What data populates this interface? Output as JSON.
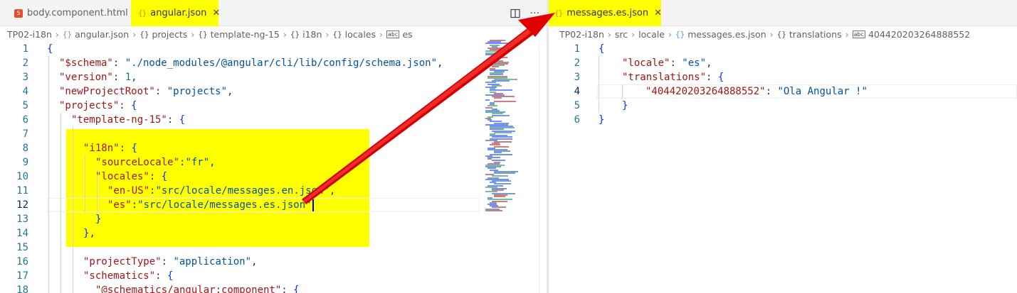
{
  "left": {
    "tabs": [
      {
        "name": "body.component.html",
        "icon": "html5-icon",
        "active": false
      },
      {
        "name": "angular.json",
        "icon": "json-braces-icon",
        "active": true,
        "close": "✕"
      }
    ],
    "actions": {
      "split": "split-editor-icon",
      "more": "···"
    },
    "breadcrumb": [
      {
        "label": "TP02-i18n",
        "icon": ""
      },
      {
        "label": "angular.json",
        "icon": "{}"
      },
      {
        "label": "projects",
        "icon": "{}"
      },
      {
        "label": "template-ng-15",
        "icon": "{}"
      },
      {
        "label": "i18n",
        "icon": "{}"
      },
      {
        "label": "locales",
        "icon": "{}"
      },
      {
        "label": "es",
        "icon": "abc"
      }
    ],
    "lines": [
      {
        "n": "1",
        "indent": 0,
        "tokens": [
          [
            "p",
            "{"
          ]
        ]
      },
      {
        "n": "2",
        "indent": 1,
        "tokens": [
          [
            "k",
            "\"$schema\""
          ],
          [
            "x",
            ": "
          ],
          [
            "s",
            "\"./node_modules/@angular/cli/lib/config/schema.json\""
          ],
          [
            "x",
            ","
          ]
        ]
      },
      {
        "n": "3",
        "indent": 1,
        "tokens": [
          [
            "k",
            "\"version\""
          ],
          [
            "x",
            ": "
          ],
          [
            "n",
            "1"
          ],
          [
            "x",
            ","
          ]
        ]
      },
      {
        "n": "4",
        "indent": 1,
        "tokens": [
          [
            "k",
            "\"newProjectRoot\""
          ],
          [
            "x",
            ": "
          ],
          [
            "s",
            "\"projects\""
          ],
          [
            "x",
            ","
          ]
        ]
      },
      {
        "n": "5",
        "indent": 1,
        "tokens": [
          [
            "k",
            "\"projects\""
          ],
          [
            "x",
            ": "
          ],
          [
            "p",
            "{"
          ]
        ]
      },
      {
        "n": "6",
        "indent": 2,
        "tokens": [
          [
            "k",
            "\"template-ng-15\""
          ],
          [
            "x",
            ": "
          ],
          [
            "p",
            "{"
          ]
        ]
      },
      {
        "n": "7",
        "indent": 0,
        "tokens": []
      },
      {
        "n": "8",
        "indent": 3,
        "tokens": [
          [
            "k",
            "\"i18n\""
          ],
          [
            "x",
            ": "
          ],
          [
            "p",
            "{"
          ]
        ]
      },
      {
        "n": "9",
        "indent": 4,
        "tokens": [
          [
            "k",
            "\"sourceLocale\""
          ],
          [
            "x",
            ":"
          ],
          [
            "s",
            "\"fr\""
          ],
          [
            "x",
            ","
          ]
        ]
      },
      {
        "n": "10",
        "indent": 4,
        "tokens": [
          [
            "k",
            "\"locales\""
          ],
          [
            "x",
            ": "
          ],
          [
            "p",
            "{"
          ]
        ]
      },
      {
        "n": "11",
        "indent": 5,
        "tokens": [
          [
            "k",
            "\"en-US\""
          ],
          [
            "x",
            ":"
          ],
          [
            "s",
            "\"src/locale/messages.en.json\""
          ],
          [
            "x",
            ","
          ]
        ]
      },
      {
        "n": "12",
        "indent": 5,
        "tokens": [
          [
            "k",
            "\"es\""
          ],
          [
            "x",
            ":"
          ],
          [
            "s",
            "\"src/locale/messages.es.json\""
          ]
        ],
        "cursor": true
      },
      {
        "n": "13",
        "indent": 4,
        "tokens": [
          [
            "p",
            "}"
          ]
        ]
      },
      {
        "n": "14",
        "indent": 3,
        "tokens": [
          [
            "p",
            "}"
          ],
          [
            "x",
            ","
          ]
        ]
      },
      {
        "n": "15",
        "indent": 0,
        "tokens": []
      },
      {
        "n": "16",
        "indent": 3,
        "tokens": [
          [
            "k",
            "\"projectType\""
          ],
          [
            "x",
            ": "
          ],
          [
            "s",
            "\"application\""
          ],
          [
            "x",
            ","
          ]
        ]
      },
      {
        "n": "17",
        "indent": 3,
        "tokens": [
          [
            "k",
            "\"schematics\""
          ],
          [
            "x",
            ": "
          ],
          [
            "p",
            "{"
          ]
        ]
      },
      {
        "n": "18",
        "indent": 4,
        "tokens": [
          [
            "k",
            "\"@schematics/angular:component\""
          ],
          [
            "x",
            ": "
          ],
          [
            "p",
            "{"
          ]
        ]
      }
    ]
  },
  "right": {
    "tabs": [
      {
        "name": "messages.es.json",
        "icon": "json-braces-icon",
        "active": true,
        "close": "✕"
      }
    ],
    "breadcrumb": [
      {
        "label": "TP02-i18n",
        "icon": ""
      },
      {
        "label": "src",
        "icon": ""
      },
      {
        "label": "locale",
        "icon": ""
      },
      {
        "label": "messages.es.json",
        "icon": "{}"
      },
      {
        "label": "translations",
        "icon": "{}"
      },
      {
        "label": "404420203264888552",
        "icon": "abc"
      }
    ],
    "lines": [
      {
        "n": "1",
        "indent": 0,
        "tokens": [
          [
            "p",
            "{"
          ]
        ]
      },
      {
        "n": "2",
        "indent": 1,
        "tokens": [
          [
            "k",
            "\"locale\""
          ],
          [
            "x",
            ": "
          ],
          [
            "s",
            "\"es\""
          ],
          [
            "x",
            ","
          ]
        ]
      },
      {
        "n": "3",
        "indent": 1,
        "tokens": [
          [
            "k",
            "\"translations\""
          ],
          [
            "x",
            ": "
          ],
          [
            "p",
            "{"
          ]
        ]
      },
      {
        "n": "4",
        "indent": 2,
        "tokens": [
          [
            "k",
            "\"404420203264888552\""
          ],
          [
            "x",
            ": "
          ],
          [
            "s",
            "\"Ola Angular !\""
          ]
        ]
      },
      {
        "n": "5",
        "indent": 1,
        "tokens": [
          [
            "p",
            "}"
          ]
        ]
      },
      {
        "n": "6",
        "indent": 0,
        "tokens": [
          [
            "p",
            "}"
          ]
        ]
      }
    ]
  },
  "colors": {
    "highlight": "#ffff00",
    "arrow": "#ff0000",
    "key": "#a31515",
    "string": "#0451a5",
    "number": "#098658",
    "brace": "#0431fa",
    "line_number": "#237893"
  }
}
